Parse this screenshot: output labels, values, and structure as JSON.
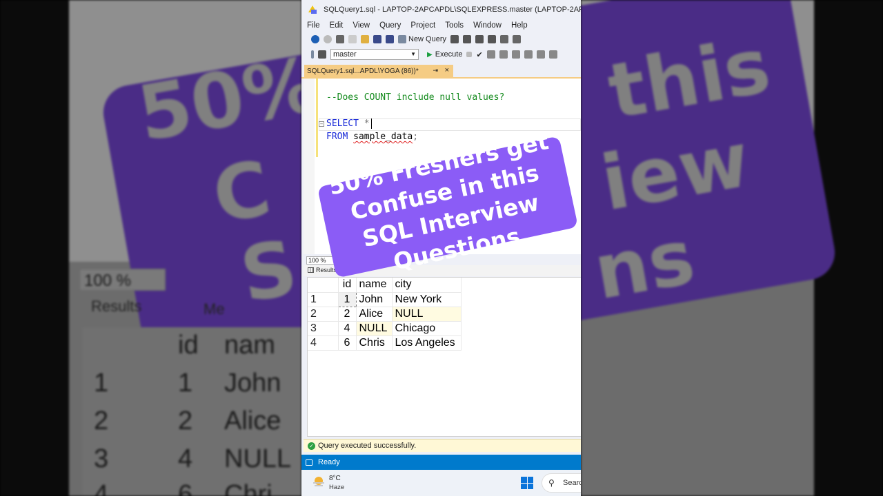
{
  "window": {
    "title": "SQLQuery1.sql - LAPTOP-2APCAPDL\\SQLEXPRESS.master (LAPTOP-2APCA"
  },
  "menu": [
    "File",
    "Edit",
    "View",
    "Query",
    "Project",
    "Tools",
    "Window",
    "Help"
  ],
  "toolbar": {
    "new_query": "New Query",
    "database": "master",
    "execute": "Execute"
  },
  "tab": {
    "label": "SQLQuery1.sql...APDL\\YOGA (86))*",
    "pin": "⇥",
    "close": "×"
  },
  "editor": {
    "comment": "--Does COUNT include null values?",
    "select_kw": "SELECT",
    "select_rest": " *",
    "from_kw": "FROM",
    "table_name": "sample_data",
    "semicolon": ";"
  },
  "zoom": "100 %",
  "result_tabs": {
    "results": "Results",
    "messages": "Me"
  },
  "grid": {
    "columns": [
      "id",
      "name",
      "city"
    ],
    "rows": [
      {
        "n": "1",
        "id": "1",
        "name": "John",
        "city": "New York"
      },
      {
        "n": "2",
        "id": "2",
        "name": "Alice",
        "city": "NULL"
      },
      {
        "n": "3",
        "id": "4",
        "name": "NULL",
        "city": "Chicago"
      },
      {
        "n": "4",
        "id": "6",
        "name": "Chris",
        "city": "Los Angeles"
      }
    ]
  },
  "status": {
    "query_ok": "Query executed successfully.",
    "ready": "Ready"
  },
  "taskbar": {
    "temp": "8°C",
    "weather": "Haze",
    "search": "Searc"
  },
  "overlay": {
    "line1": "50% Freshers get",
    "line2": "Confuse in this",
    "line3": "SQL Interview",
    "line4": "Questions"
  },
  "background": {
    "zoom": "100 %",
    "results": "Results",
    "messages": "Me",
    "big_left_top": "50%",
    "big_left_mid": "C",
    "big_left_bot": "S",
    "big_right_top": "this",
    "big_right_mid": "iew",
    "big_right_bot": "ns",
    "grid_header_id": "id",
    "grid_header_name": "nam",
    "grid_rows": [
      {
        "n": "1",
        "id": "1",
        "name": "John"
      },
      {
        "n": "2",
        "id": "2",
        "name": "Alice"
      },
      {
        "n": "3",
        "id": "4",
        "name": "NULL"
      },
      {
        "n": "4",
        "id": "6",
        "name": "Chri"
      }
    ]
  },
  "colors": {
    "accent": "#007acc",
    "tab_active": "#f5cc84",
    "banner": "#8b5cf6",
    "keyword": "#1a2bd8",
    "comment": "#138a1c"
  }
}
